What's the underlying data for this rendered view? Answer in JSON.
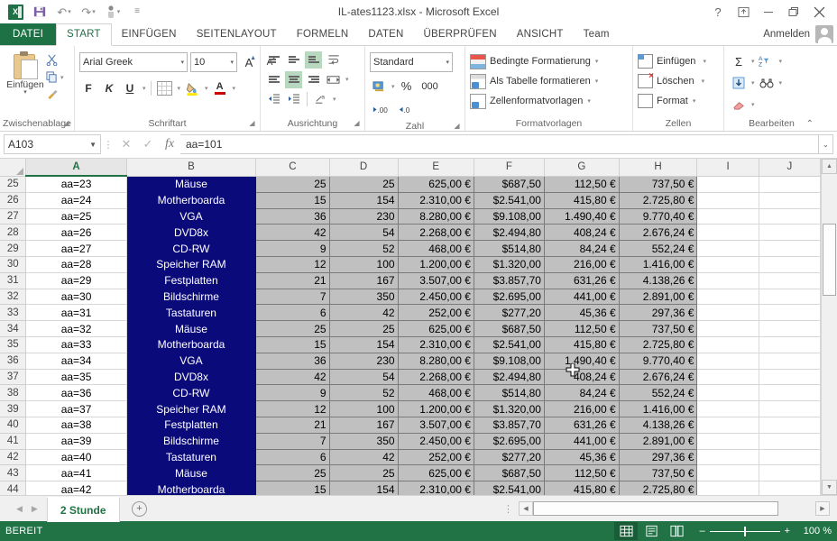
{
  "titlebar": {
    "document_title": "IL-ates1123.xlsx - Microsoft Excel",
    "qat": [
      {
        "name": "excel-logo-icon",
        "label": "X"
      },
      {
        "name": "save-icon",
        "label": "💾"
      },
      {
        "name": "undo-icon",
        "label": "↶"
      },
      {
        "name": "redo-icon",
        "label": "↷"
      },
      {
        "name": "touch-mode-icon",
        "label": "☝"
      },
      {
        "name": "customize-qat-icon",
        "label": "☰"
      }
    ],
    "help_label": "?",
    "ribbon_display_label": "⬆",
    "minimize_label": "—",
    "restore_label": "❐",
    "close_label": "✕"
  },
  "tabs": {
    "file": "DATEI",
    "items": [
      "START",
      "EINFÜGEN",
      "SEITENLAYOUT",
      "FORMELN",
      "DATEN",
      "ÜBERPRÜFEN",
      "ANSICHT",
      "Team"
    ],
    "active": "START",
    "signin": "Anmelden"
  },
  "ribbon": {
    "clipboard": {
      "group_label": "Zwischenablage",
      "paste_label": "Einfügen",
      "cut_label": "✂",
      "copy_label": "⧉",
      "format_painter_label": "🖌"
    },
    "font": {
      "group_label": "Schriftart",
      "font_name": "Arial Greek",
      "font_size": "10",
      "grow_label": "A",
      "shrink_label": "A",
      "bold_label": "F",
      "italic_label": "K",
      "underline_label": "U",
      "borders_label": "borders",
      "fill_color_label": "🎨",
      "font_color_label": "A"
    },
    "alignment": {
      "group_label": "Ausrichtung",
      "align_top": "align-top",
      "align_middle": "align-middle",
      "align_bottom": "align-bottom",
      "wrap_text": "wrap-text",
      "align_left": "align-left",
      "align_center": "align-center",
      "align_right": "align-right",
      "merge_center": "merge-center",
      "decrease_indent": "←",
      "increase_indent": "→",
      "orientation": "⤴"
    },
    "number": {
      "group_label": "Zahl",
      "format": "Standard",
      "currency_label": "€",
      "percent_label": "%",
      "thousands_label": "000",
      "increase_decimal": ".00",
      "decrease_decimal": ".0"
    },
    "styles": {
      "group_label": "Formatvorlagen",
      "conditional": "Bedingte Formatierung",
      "as_table": "Als Tabelle formatieren",
      "cell_styles": "Zellenformatvorlagen"
    },
    "cells": {
      "group_label": "Zellen",
      "insert": "Einfügen",
      "delete": "Löschen",
      "format": "Format"
    },
    "editing": {
      "group_label": "Bearbeiten",
      "autosum": "Σ",
      "sort_filter": "AZ",
      "fill": "⬇",
      "find_select": "🔍",
      "clear": "✐",
      "collapse": "⌃"
    }
  },
  "formula_bar": {
    "name_box": "A103",
    "cancel_label": "✕",
    "confirm_label": "✓",
    "fx_label": "fx",
    "formula": "aa=101",
    "expand_label": "⌄"
  },
  "grid": {
    "columns": [
      "A",
      "B",
      "C",
      "D",
      "E",
      "F",
      "G",
      "H",
      "I",
      "J"
    ],
    "active_column": "A",
    "rows": [
      {
        "n": "25",
        "a": "aa=23",
        "b": "Mäuse",
        "c": "25",
        "d": "25",
        "e": "625,00 €",
        "f": "$687,50",
        "g": "112,50 €",
        "h": "737,50 €"
      },
      {
        "n": "26",
        "a": "aa=24",
        "b": "Motherboarda",
        "c": "15",
        "d": "154",
        "e": "2.310,00 €",
        "f": "$2.541,00",
        "g": "415,80 €",
        "h": "2.725,80 €"
      },
      {
        "n": "27",
        "a": "aa=25",
        "b": "VGA",
        "c": "36",
        "d": "230",
        "e": "8.280,00 €",
        "f": "$9.108,00",
        "g": "1.490,40 €",
        "h": "9.770,40 €"
      },
      {
        "n": "28",
        "a": "aa=26",
        "b": "DVD8x",
        "c": "42",
        "d": "54",
        "e": "2.268,00 €",
        "f": "$2.494,80",
        "g": "408,24 €",
        "h": "2.676,24 €"
      },
      {
        "n": "29",
        "a": "aa=27",
        "b": "CD-RW",
        "c": "9",
        "d": "52",
        "e": "468,00 €",
        "f": "$514,80",
        "g": "84,24 €",
        "h": "552,24 €"
      },
      {
        "n": "30",
        "a": "aa=28",
        "b": "Speicher RAM",
        "c": "12",
        "d": "100",
        "e": "1.200,00 €",
        "f": "$1.320,00",
        "g": "216,00 €",
        "h": "1.416,00 €"
      },
      {
        "n": "31",
        "a": "aa=29",
        "b": "Festplatten",
        "c": "21",
        "d": "167",
        "e": "3.507,00 €",
        "f": "$3.857,70",
        "g": "631,26 €",
        "h": "4.138,26 €"
      },
      {
        "n": "32",
        "a": "aa=30",
        "b": "Bildschirme",
        "c": "7",
        "d": "350",
        "e": "2.450,00 €",
        "f": "$2.695,00",
        "g": "441,00 €",
        "h": "2.891,00 €"
      },
      {
        "n": "33",
        "a": "aa=31",
        "b": "Tastaturen",
        "c": "6",
        "d": "42",
        "e": "252,00 €",
        "f": "$277,20",
        "g": "45,36 €",
        "h": "297,36 €"
      },
      {
        "n": "34",
        "a": "aa=32",
        "b": "Mäuse",
        "c": "25",
        "d": "25",
        "e": "625,00 €",
        "f": "$687,50",
        "g": "112,50 €",
        "h": "737,50 €"
      },
      {
        "n": "35",
        "a": "aa=33",
        "b": "Motherboarda",
        "c": "15",
        "d": "154",
        "e": "2.310,00 €",
        "f": "$2.541,00",
        "g": "415,80 €",
        "h": "2.725,80 €"
      },
      {
        "n": "36",
        "a": "aa=34",
        "b": "VGA",
        "c": "36",
        "d": "230",
        "e": "8.280,00 €",
        "f": "$9.108,00",
        "g": "1.490,40 €",
        "h": "9.770,40 €"
      },
      {
        "n": "37",
        "a": "aa=35",
        "b": "DVD8x",
        "c": "42",
        "d": "54",
        "e": "2.268,00 €",
        "f": "$2.494,80",
        "g": "408,24 €",
        "h": "2.676,24 €"
      },
      {
        "n": "38",
        "a": "aa=36",
        "b": "CD-RW",
        "c": "9",
        "d": "52",
        "e": "468,00 €",
        "f": "$514,80",
        "g": "84,24 €",
        "h": "552,24 €"
      },
      {
        "n": "39",
        "a": "aa=37",
        "b": "Speicher RAM",
        "c": "12",
        "d": "100",
        "e": "1.200,00 €",
        "f": "$1.320,00",
        "g": "216,00 €",
        "h": "1.416,00 €"
      },
      {
        "n": "40",
        "a": "aa=38",
        "b": "Festplatten",
        "c": "21",
        "d": "167",
        "e": "3.507,00 €",
        "f": "$3.857,70",
        "g": "631,26 €",
        "h": "4.138,26 €"
      },
      {
        "n": "41",
        "a": "aa=39",
        "b": "Bildschirme",
        "c": "7",
        "d": "350",
        "e": "2.450,00 €",
        "f": "$2.695,00",
        "g": "441,00 €",
        "h": "2.891,00 €"
      },
      {
        "n": "42",
        "a": "aa=40",
        "b": "Tastaturen",
        "c": "6",
        "d": "42",
        "e": "252,00 €",
        "f": "$277,20",
        "g": "45,36 €",
        "h": "297,36 €"
      },
      {
        "n": "43",
        "a": "aa=41",
        "b": "Mäuse",
        "c": "25",
        "d": "25",
        "e": "625,00 €",
        "f": "$687,50",
        "g": "112,50 €",
        "h": "737,50 €"
      },
      {
        "n": "44",
        "a": "aa=42",
        "b": "Motherboarda",
        "c": "15",
        "d": "154",
        "e": "2.310,00 €",
        "f": "$2.541,00",
        "g": "415,80 €",
        "h": "2.725,80 €"
      }
    ]
  },
  "sheet_tabs": {
    "prev_label": "◀",
    "next_label": "▶",
    "sheets": [
      "2 Stunde"
    ],
    "active_sheet": "2 Stunde",
    "new_sheet_label": "+",
    "more_label": "⋮"
  },
  "status_bar": {
    "mode": "BEREIT",
    "view_normal": "normal-view",
    "view_layout": "page-layout-view",
    "view_break": "page-break-view",
    "zoom_out": "–",
    "zoom_in": "+",
    "zoom_level": "100 %"
  },
  "colors": {
    "excel_green": "#217346",
    "file_tab_green": "#1e7145",
    "selection_blue": "#0a0a7a",
    "number_cell_gray": "#c0c0c0"
  }
}
